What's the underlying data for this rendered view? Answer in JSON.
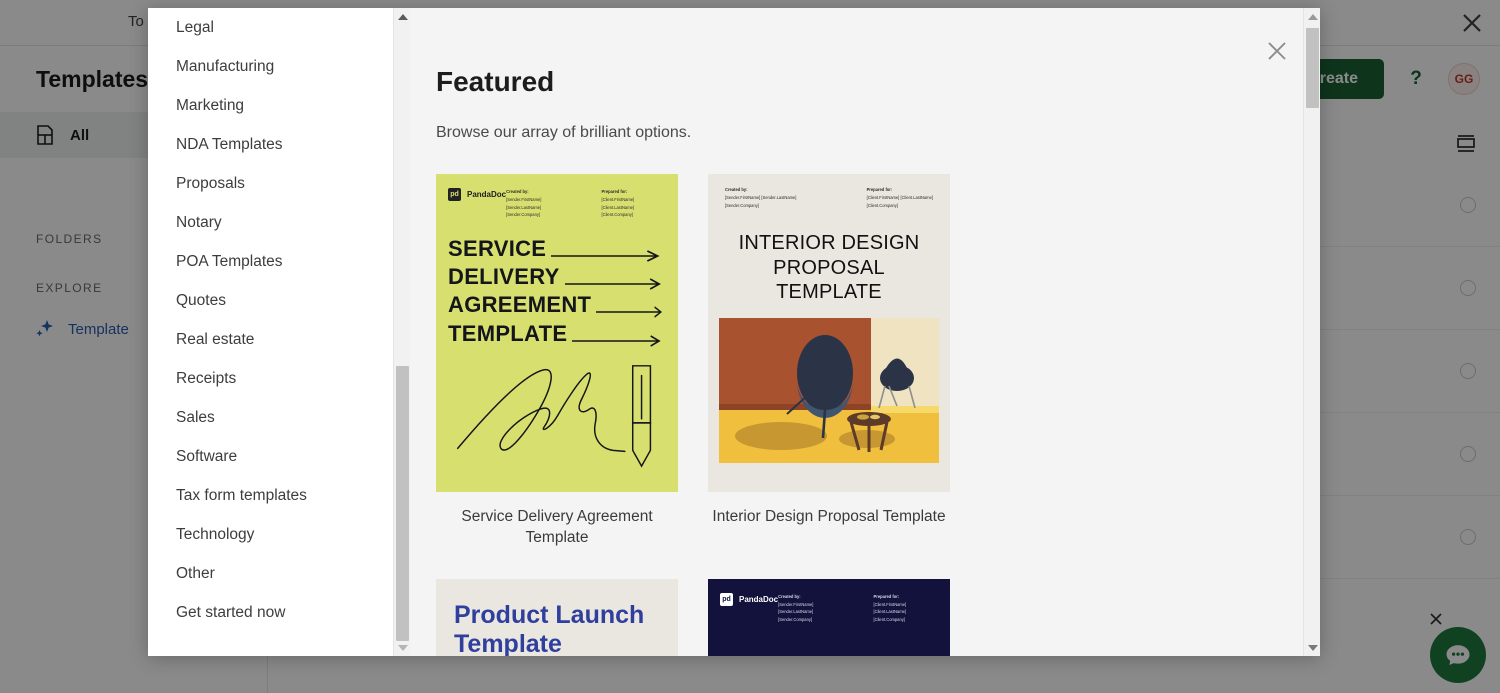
{
  "browser": {
    "tab_title": "To",
    "close_icon": "close-icon"
  },
  "background_app": {
    "sidebar": {
      "title": "Templates",
      "all_label": "All",
      "all_icon": "document-icon",
      "sections": [
        {
          "label": "FOLDERS"
        },
        {
          "label": "EXPLORE"
        }
      ],
      "explore_item": {
        "label": "Template",
        "icon": "sparkle-icon",
        "color": "#2a5db0"
      }
    },
    "toolbar": {
      "create_label": "Create",
      "create_color": "#1a6135",
      "help_label": "?",
      "avatar_initials": "GG",
      "avatar_color": "#c0392b",
      "view_toggle_icon": "layout-view-icon"
    },
    "rows_count": 5,
    "chat": {
      "icon": "chat-bubble-icon",
      "dismiss_icon": "close-icon",
      "color": "#1f7a3f"
    }
  },
  "modal": {
    "close_icon": "close-icon",
    "nav": {
      "items": [
        {
          "label": "Legal"
        },
        {
          "label": "Manufacturing"
        },
        {
          "label": "Marketing"
        },
        {
          "label": "NDA Templates"
        },
        {
          "label": "Proposals"
        },
        {
          "label": "Notary"
        },
        {
          "label": "POA Templates"
        },
        {
          "label": "Quotes"
        },
        {
          "label": "Real estate"
        },
        {
          "label": "Receipts"
        },
        {
          "label": "Sales"
        },
        {
          "label": "Software"
        },
        {
          "label": "Tax form templates"
        },
        {
          "label": "Technology"
        },
        {
          "label": "Other"
        },
        {
          "label": "Get started now"
        }
      ],
      "scrollbar": {
        "up_arrow": "chevron-up-icon",
        "down_arrow": "chevron-down-icon"
      }
    },
    "content": {
      "title": "Featured",
      "subtitle": "Browse our array of brilliant options.",
      "scrollbar": {
        "up_arrow": "chevron-up-icon",
        "down_arrow": "chevron-down-icon"
      },
      "doc_meta": {
        "created_by_label": "Created by:",
        "created_by_name": "[Sender.FirstName] [Sender.LastName]",
        "created_by_company": "[Sender.Company]",
        "prepared_for_label": "Prepared for:",
        "prepared_for_name": "[Client.FirstName] [Client.LastName]",
        "prepared_for_company": "[Client.Company]"
      },
      "brand": {
        "mark": "pd",
        "name": "PandaDoc"
      },
      "cards": [
        {
          "caption": "Service Delivery Agreement Template",
          "thumb_style": "lime",
          "thumb_color": "#d7e06f",
          "lines": [
            "SERVICE",
            "DELIVERY",
            "AGREEMENT",
            "TEMPLATE"
          ]
        },
        {
          "caption": "Interior Design Proposal Template",
          "thumb_style": "cream",
          "thumb_color": "#eae7e0",
          "title_lines": [
            "INTERIOR DESIGN",
            "PROPOSAL",
            "TEMPLATE"
          ]
        },
        {
          "caption": "",
          "thumb_style": "product-launch",
          "thumb_color": "#eae7e0",
          "title_lines": [
            "Product Launch",
            "Template"
          ]
        },
        {
          "caption": "",
          "thumb_style": "navy",
          "thumb_color": "#12123c"
        }
      ]
    }
  }
}
